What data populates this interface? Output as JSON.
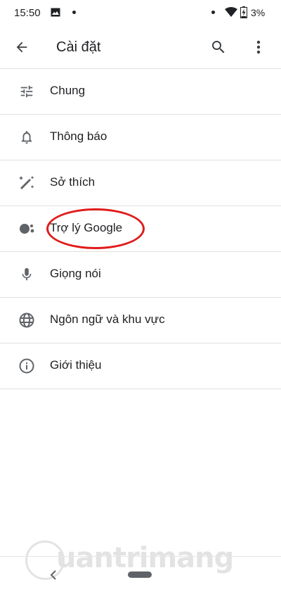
{
  "status_bar": {
    "time": "15:50",
    "battery": "3%",
    "icons": [
      "photo-icon",
      "dot-icon",
      "dot-icon",
      "wifi-icon",
      "battery-charging-icon"
    ]
  },
  "app_bar": {
    "title": "Cài đặt",
    "back_icon": "arrow-left-icon",
    "search_icon": "search-icon",
    "more_icon": "more-vert-icon"
  },
  "menu": {
    "items": [
      {
        "label": "Chung",
        "icon": "tune-icon"
      },
      {
        "label": "Thông báo",
        "icon": "bell-icon"
      },
      {
        "label": "Sở thích",
        "icon": "magic-wand-icon"
      },
      {
        "label": "Trợ lý Google",
        "icon": "assistant-dots-icon",
        "highlighted": true
      },
      {
        "label": "Giọng nói",
        "icon": "microphone-icon"
      },
      {
        "label": "Ngôn ngữ và khu vực",
        "icon": "globe-icon"
      },
      {
        "label": "Giới thiệu",
        "icon": "info-icon"
      }
    ]
  },
  "annotation": {
    "color": "#e01b1b",
    "target": "Trợ lý Google"
  },
  "nav_bar": {
    "back_icon": "nav-back-icon",
    "home": "home-pill"
  },
  "watermark": {
    "text": "uantrimang"
  },
  "colors": {
    "text": "#202124",
    "icon": "#5f6368",
    "divider": "#e0e0e0",
    "highlight": "#e01b1b"
  }
}
